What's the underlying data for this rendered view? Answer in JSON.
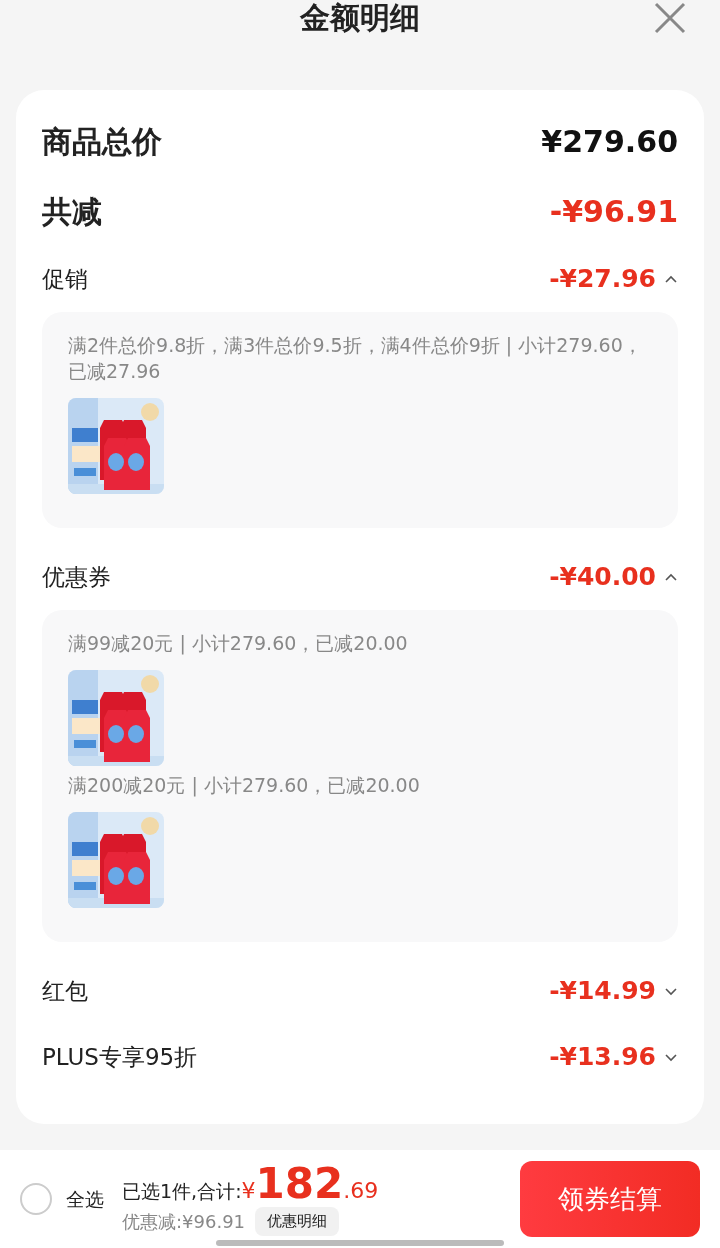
{
  "header": {
    "title": "金额明细"
  },
  "summary": [
    {
      "label": "商品总价",
      "amount": "¥279.60",
      "kind": "total"
    },
    {
      "label": "共减",
      "amount": "-¥96.91",
      "kind": "discount"
    }
  ],
  "sections": [
    {
      "label": "促销",
      "amount": "-¥27.96",
      "expanded": true,
      "groups": [
        {
          "text": "满2件总价9.8折，满3件总价9.5折，满4件总价9折 | 小计279.60，已减27.96"
        }
      ]
    },
    {
      "label": "优惠券",
      "amount": "-¥40.00",
      "expanded": true,
      "groups": [
        {
          "text": "满99减20元 | 小计279.60，已减20.00"
        },
        {
          "text": "满200减20元 | 小计279.60，已减20.00"
        }
      ]
    },
    {
      "label": "红包",
      "amount": "-¥14.99",
      "expanded": false
    },
    {
      "label": "PLUS专享95折",
      "amount": "-¥13.96",
      "expanded": false
    }
  ],
  "footer": {
    "select_all": {
      "label": "全选",
      "checked": false
    },
    "summary": "已选1件,合计:",
    "currency": "¥",
    "integer": "182",
    "decimal": ".69",
    "saving": "优惠减:¥96.91",
    "detail_button": "优惠明细",
    "checkout_button": "领券结算"
  }
}
